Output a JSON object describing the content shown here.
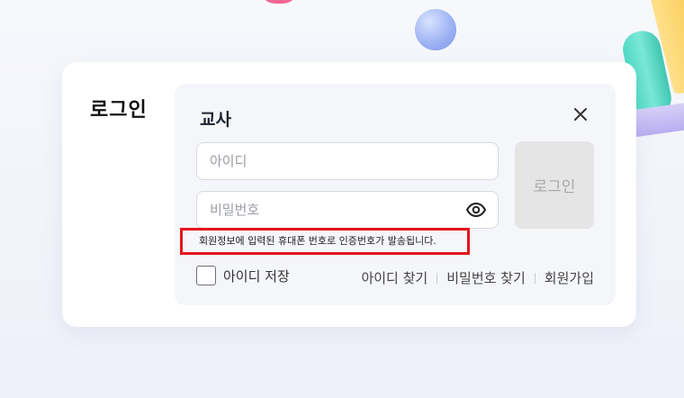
{
  "modal": {
    "title": "로그인",
    "panel_title": "교사",
    "id_placeholder": "아이디",
    "pw_placeholder": "비밀번호",
    "login_label": "로그인",
    "notice": "회원정보에 입력된 휴대폰 번호로 인증번호가 발송됩니다.",
    "remember_label": "아이디 저장",
    "links": {
      "find_id": "아이디 찾기",
      "find_pw": "비밀번호 찾기",
      "signup": "회원가입"
    }
  },
  "icons": {
    "close": "close-icon",
    "eye": "eye-icon"
  },
  "colors": {
    "notice_border": "#e5151d",
    "login_button_bg": "#e5e5e6",
    "panel_bg": "#f5f6f9"
  }
}
